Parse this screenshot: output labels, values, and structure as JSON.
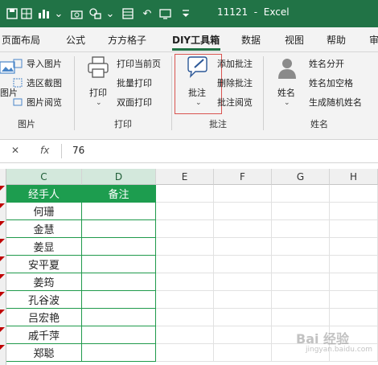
{
  "window": {
    "title": "11121  -  Excel"
  },
  "tabs": [
    "页面布局",
    "公式",
    "方方格子",
    "DIY工具箱",
    "数据",
    "视图",
    "帮助",
    "审"
  ],
  "active_tab": "DIY工具箱",
  "ribbon": {
    "picture": {
      "big_label": "图片",
      "items": [
        "导入图片",
        "选区截图",
        "图片阅览"
      ],
      "group": "图片"
    },
    "print": {
      "big_label": "打印",
      "items": [
        "打印当前页",
        "批量打印",
        "双面打印"
      ],
      "group": "打印"
    },
    "comment": {
      "big_label": "批注",
      "items": [
        "添加批注",
        "删除批注",
        "批注阅览"
      ],
      "group": "批注"
    },
    "name": {
      "big_label": "姓名",
      "items": [
        "姓名分开",
        "姓名加空格",
        "生成随机姓名"
      ],
      "group": "姓名"
    }
  },
  "formula_bar": {
    "cancel": "✕",
    "confirm": "✓",
    "fx": "fx",
    "value": "76"
  },
  "columns": [
    "C",
    "D",
    "E",
    "F",
    "G",
    "H"
  ],
  "selected_columns": [
    "C",
    "D"
  ],
  "table": {
    "headers": [
      "经手人",
      "备注"
    ],
    "rows": [
      "何珊",
      "金慧",
      "姜显",
      "安平夏",
      "姜筠",
      "孔谷波",
      "吕宏艳",
      "戚千萍",
      "郑聪"
    ]
  },
  "colors": {
    "excel_green": "#217346",
    "header_fill": "#1d9d4f",
    "comment_marker": "#c00000"
  },
  "watermark": {
    "line1": "Bai 经验",
    "line2": "jingyan.baidu.com"
  }
}
